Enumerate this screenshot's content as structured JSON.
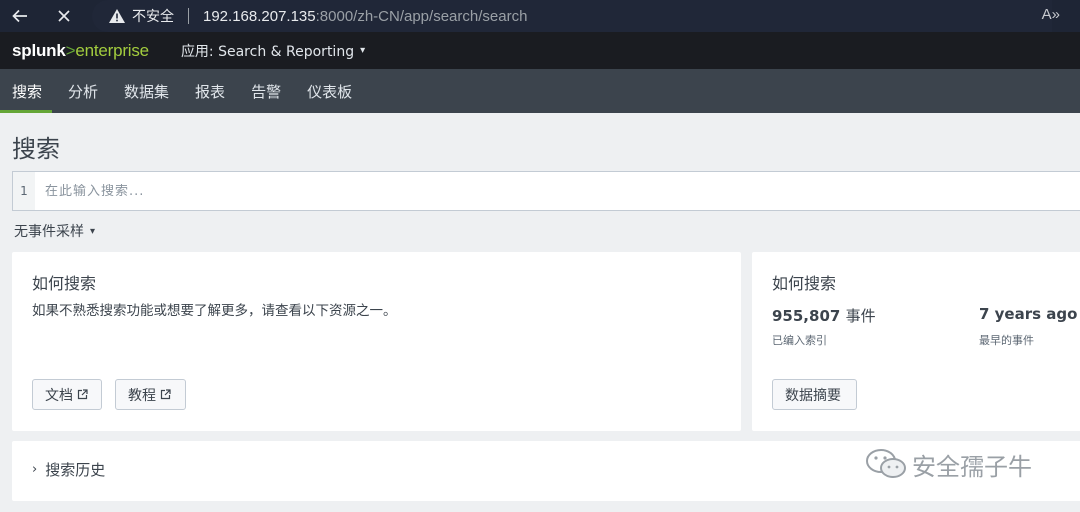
{
  "browser": {
    "security_label": "不安全",
    "url_host": "192.168.207.135",
    "url_rest": ":8000/zh-CN/app/search/search",
    "read_aloud": "A»"
  },
  "header": {
    "logo_brand": "splunk",
    "logo_gt": ">",
    "logo_product": "enterprise",
    "app_menu_label": "应用: Search & Reporting",
    "caret": "▾"
  },
  "nav": {
    "items": [
      {
        "label": "搜索"
      },
      {
        "label": "分析"
      },
      {
        "label": "数据集"
      },
      {
        "label": "报表"
      },
      {
        "label": "告警"
      },
      {
        "label": "仪表板"
      }
    ]
  },
  "page": {
    "title": "搜索",
    "search_line_number": "1",
    "search_placeholder": "在此输入搜索...",
    "sampling_label": "无事件采样",
    "sampling_caret": "▾"
  },
  "how_to": {
    "title": "如何搜索",
    "description": "如果不熟悉搜索功能或想要了解更多，请查看以下资源之一。",
    "docs_label": "文档",
    "tutorial_label": "教程"
  },
  "data_panel": {
    "title": "如何搜索",
    "events_count": "955,807",
    "events_unit": "事件",
    "events_sub": "已编入索引",
    "earliest_value": "7 years ago",
    "earliest_sub": "最早的事件",
    "summary_label": "数据摘要"
  },
  "history": {
    "chevron": "›",
    "label": "搜索历史"
  },
  "watermark": {
    "text": "安全孺子牛"
  }
}
